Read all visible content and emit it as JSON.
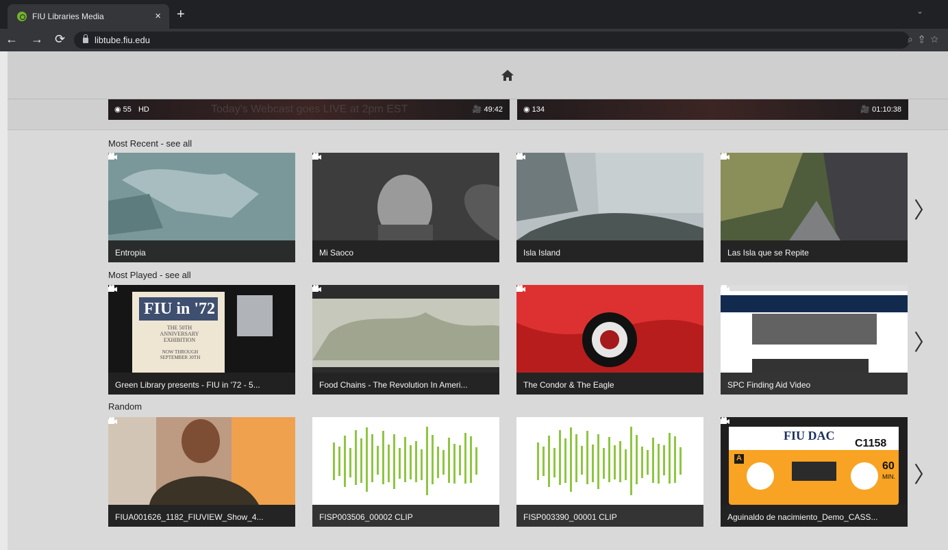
{
  "browser": {
    "tab_title": "FIU Libraries Media",
    "close_symbol": "×",
    "new_tab_symbol": "+",
    "address": "libtube.fiu.edu"
  },
  "featured": [
    {
      "views": "55",
      "quality": "HD",
      "webcast": "Today's Webcast goes LIVE at 2pm EST",
      "duration": "49:42"
    },
    {
      "views": "134",
      "quality": "",
      "webcast": "",
      "duration": "01:10:38"
    }
  ],
  "sections": [
    {
      "title": "Most Recent - see all",
      "items": [
        "Entropia",
        "Mi Saoco",
        "Isla Island",
        "Las Isla que se Repite"
      ]
    },
    {
      "title": "Most Played - see all",
      "items": [
        "Green Library presents - FIU in '72 - 5...",
        "Food Chains - The Revolution In Ameri...",
        "The Condor & The Eagle",
        "SPC Finding Aid Video"
      ]
    },
    {
      "title": "Random",
      "items": [
        "FIUA001626_1182_FIUVIEW_Show_4...",
        "FISP003506_00002 CLIP",
        "FISP003390_00001 CLIP",
        "Aguinaldo de nacimiento_Demo_CASS..."
      ]
    }
  ],
  "thumb_text": {
    "fiu72": "FIU in '72",
    "anniv": "THE 50TH ANNIVERSARY EXHIBITION",
    "now": "NOW THROUGH SEPTEMBER 30TH",
    "fiudac": "FIU DAC",
    "tape_num": "C1158",
    "tape_a": "A",
    "tape_60": "60",
    "tape_min": "MIN."
  },
  "icons": {
    "home": "home-icon",
    "next": "chevron-right-icon",
    "views": "eye-icon",
    "camera": "video-camera-icon"
  },
  "arrow_symbol": "〉"
}
